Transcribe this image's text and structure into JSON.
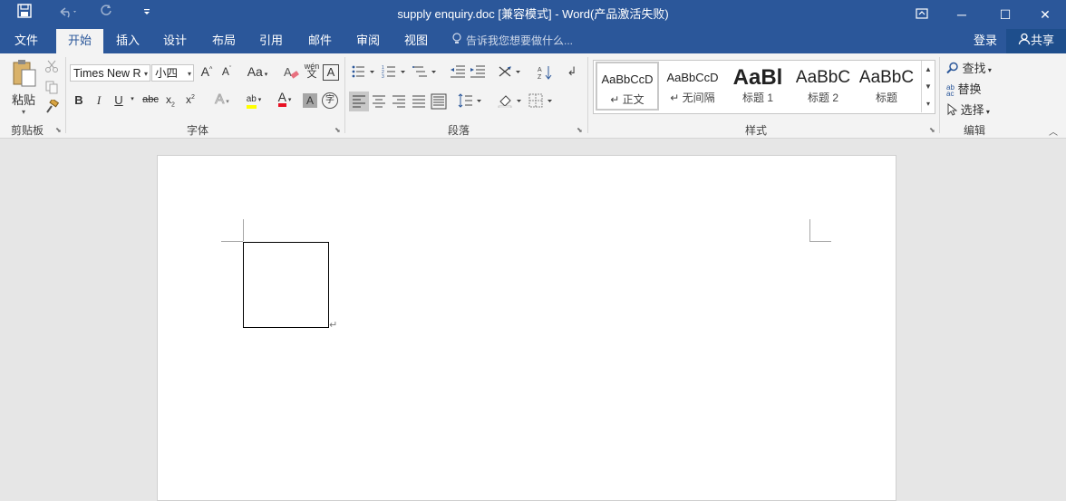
{
  "window": {
    "title": "supply enquiry.doc [兼容模式] - Word(产品激活失败)",
    "controls": {
      "restore_ribbon_icon": "ribbon-display-icon",
      "minimize": "─",
      "maximize": "☐",
      "close": "✕"
    }
  },
  "quick_access": {
    "save_icon": "save-icon",
    "undo_icon": "undo-icon",
    "redo_icon": "redo-icon",
    "customize_icon": "customize-icon"
  },
  "tabs": [
    "文件",
    "开始",
    "插入",
    "设计",
    "布局",
    "引用",
    "邮件",
    "审阅",
    "视图"
  ],
  "active_tab": "开始",
  "tell_me": "告诉我您想要做什么...",
  "login": "登录",
  "share": "共享",
  "clipboard": {
    "paste_label": "粘贴",
    "group_label": "剪贴板"
  },
  "font": {
    "font_name": "Times New R",
    "font_size": "小四",
    "group_label": "字体",
    "grow": "A",
    "shrink": "A",
    "change_case": "Aa",
    "phonetic": "wén",
    "phonetic_sub": "文",
    "border": "A",
    "bold": "B",
    "italic": "I",
    "underline": "U",
    "strike": "abc",
    "sub": "x",
    "sup": "x",
    "effects": "A",
    "highlight": "ab",
    "font_color": "A",
    "shading": "A",
    "enclose": "字"
  },
  "paragraph": {
    "group_label": "段落"
  },
  "styles": {
    "group_label": "样式",
    "items": [
      {
        "preview": "AaBbCcD",
        "name": "↵ 正文"
      },
      {
        "preview": "AaBbCcD",
        "name": "↵ 无间隔"
      },
      {
        "preview": "AaBl",
        "name": "标题 1"
      },
      {
        "preview": "AaBbC",
        "name": "标题 2"
      },
      {
        "preview": "AaBbC",
        "name": "标题"
      }
    ]
  },
  "editing": {
    "group_label": "编辑",
    "find": "查找",
    "replace": "替换",
    "select": "选择"
  },
  "colors": {
    "accent": "#2b579a",
    "highlight": "#ffff00",
    "font_color": "#e81123"
  },
  "document": {
    "paragraph_mark": "↵"
  }
}
